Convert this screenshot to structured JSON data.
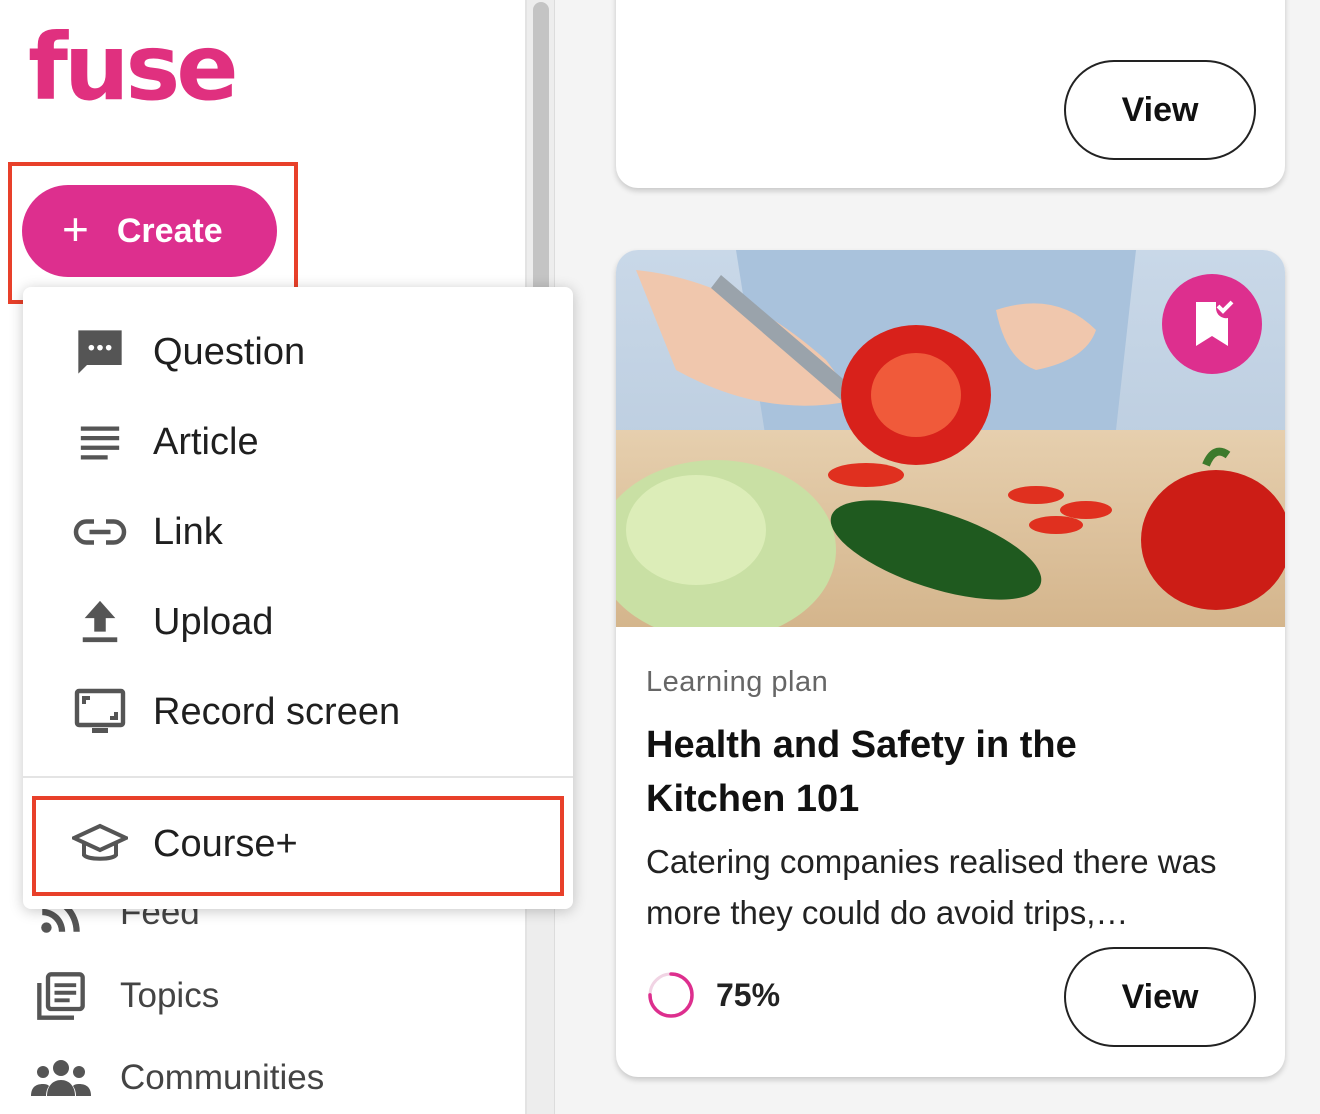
{
  "app": {
    "logo_text": "fuse"
  },
  "sidebar": {
    "create_label": "Create",
    "nav_items": [
      {
        "label": "Feed",
        "icon": "rss-icon"
      },
      {
        "label": "Topics",
        "icon": "topics-icon"
      },
      {
        "label": "Communities",
        "icon": "people-icon"
      }
    ]
  },
  "create_menu": {
    "items": [
      {
        "label": "Question",
        "icon": "chat-bubble-icon"
      },
      {
        "label": "Article",
        "icon": "article-lines-icon"
      },
      {
        "label": "Link",
        "icon": "link-icon"
      },
      {
        "label": "Upload",
        "icon": "upload-icon"
      },
      {
        "label": "Record screen",
        "icon": "record-screen-icon"
      },
      {
        "label": "Course+",
        "icon": "graduation-cap-icon"
      }
    ]
  },
  "cards": [
    {
      "view_label": "View"
    },
    {
      "type": "Learning plan",
      "title": "Health and Safety in the Kitchen 101",
      "description": "Catering companies realised there was more they could do avoid trips,…",
      "progress_text": "75%",
      "progress_fraction": 0.75,
      "view_label": "View",
      "badge_icon": "bookmark-check-icon"
    }
  ],
  "colors": {
    "brand": "#dd2f8e",
    "highlight": "#e8402a"
  }
}
